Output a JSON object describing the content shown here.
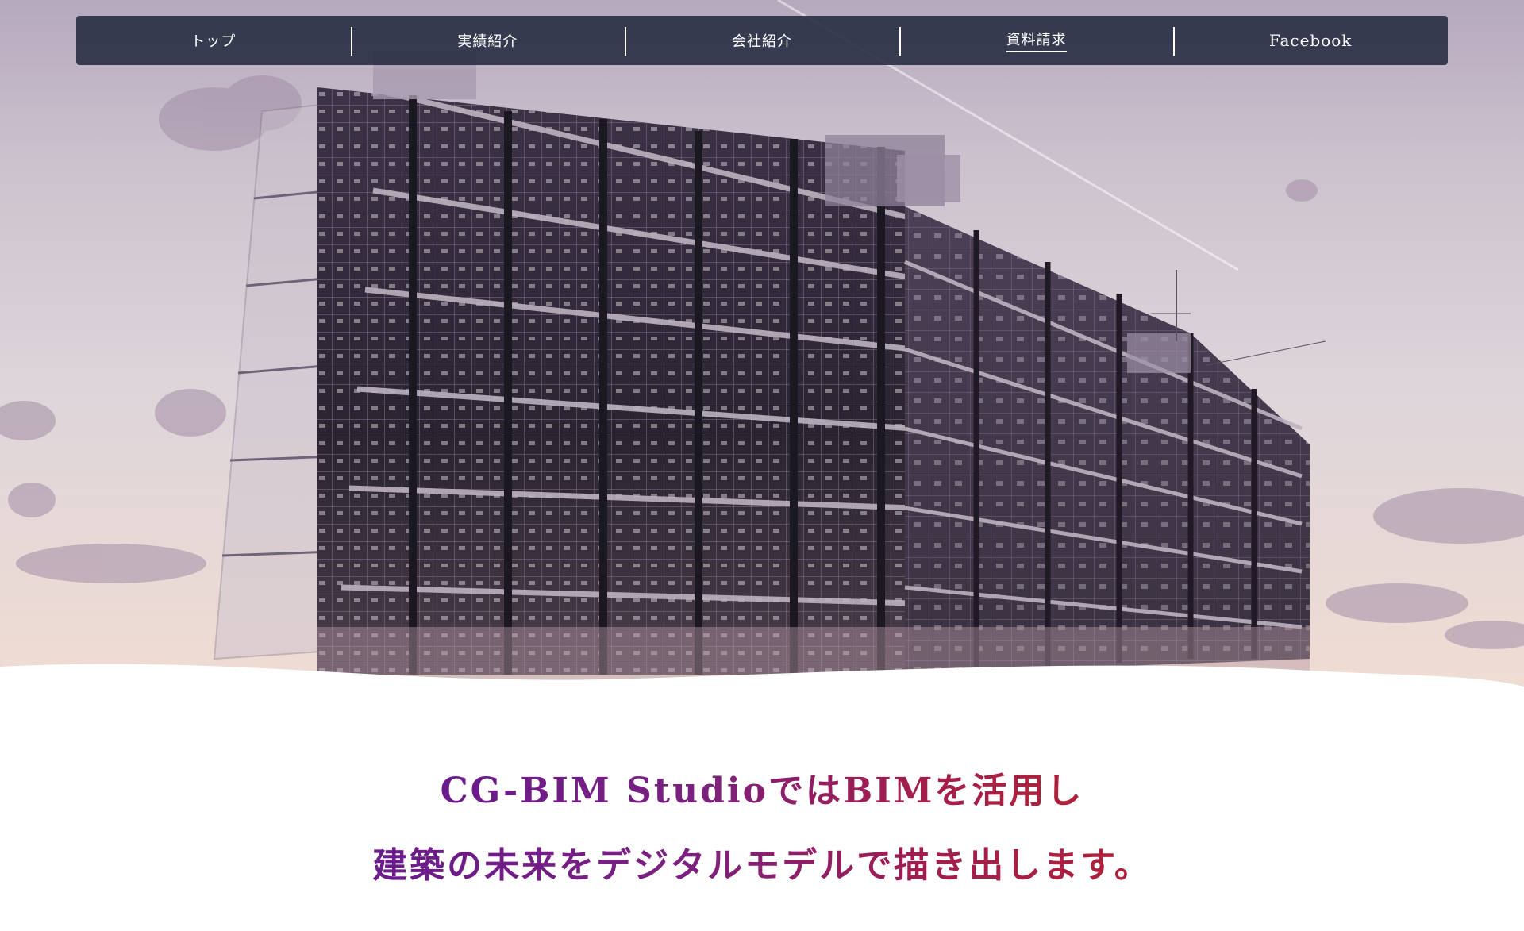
{
  "nav": {
    "items": [
      {
        "label": "トップ"
      },
      {
        "label": "実績紹介"
      },
      {
        "label": "会社紹介"
      },
      {
        "label": "資料請求"
      },
      {
        "label": "Facebook"
      }
    ],
    "active_index": 3
  },
  "tagline": {
    "line1": "CG-BIM StudioではBIMを活用し",
    "line2": "建築の未来をデジタルモデルで描き出します。"
  },
  "colors": {
    "nav_background": "#2c3146",
    "nav_text": "#ffffff",
    "tagline_start": "#6a1b8c",
    "tagline_end": "#b02238",
    "sky": "#cbc1cd"
  }
}
